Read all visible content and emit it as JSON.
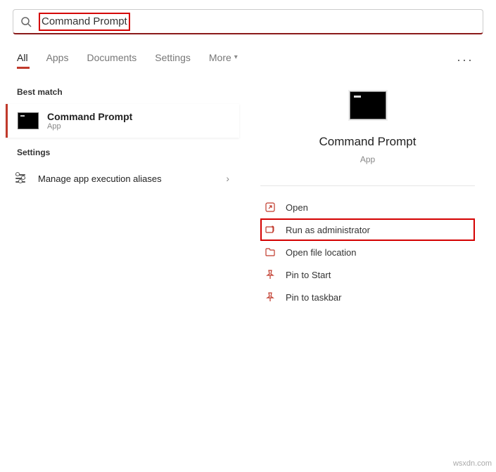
{
  "search": {
    "value": "Command Prompt"
  },
  "tabs": {
    "all": "All",
    "apps": "Apps",
    "documents": "Documents",
    "settings": "Settings",
    "more": "More"
  },
  "results": {
    "best_match_label": "Best match",
    "item": {
      "title": "Command Prompt",
      "subtitle": "App"
    },
    "settings_label": "Settings",
    "settings_item": {
      "title": "Manage app execution aliases"
    }
  },
  "preview": {
    "title": "Command Prompt",
    "subtitle": "App"
  },
  "actions": {
    "open": "Open",
    "run_admin": "Run as administrator",
    "open_location": "Open file location",
    "pin_start": "Pin to Start",
    "pin_taskbar": "Pin to taskbar"
  },
  "watermark": "wsxdn.com"
}
